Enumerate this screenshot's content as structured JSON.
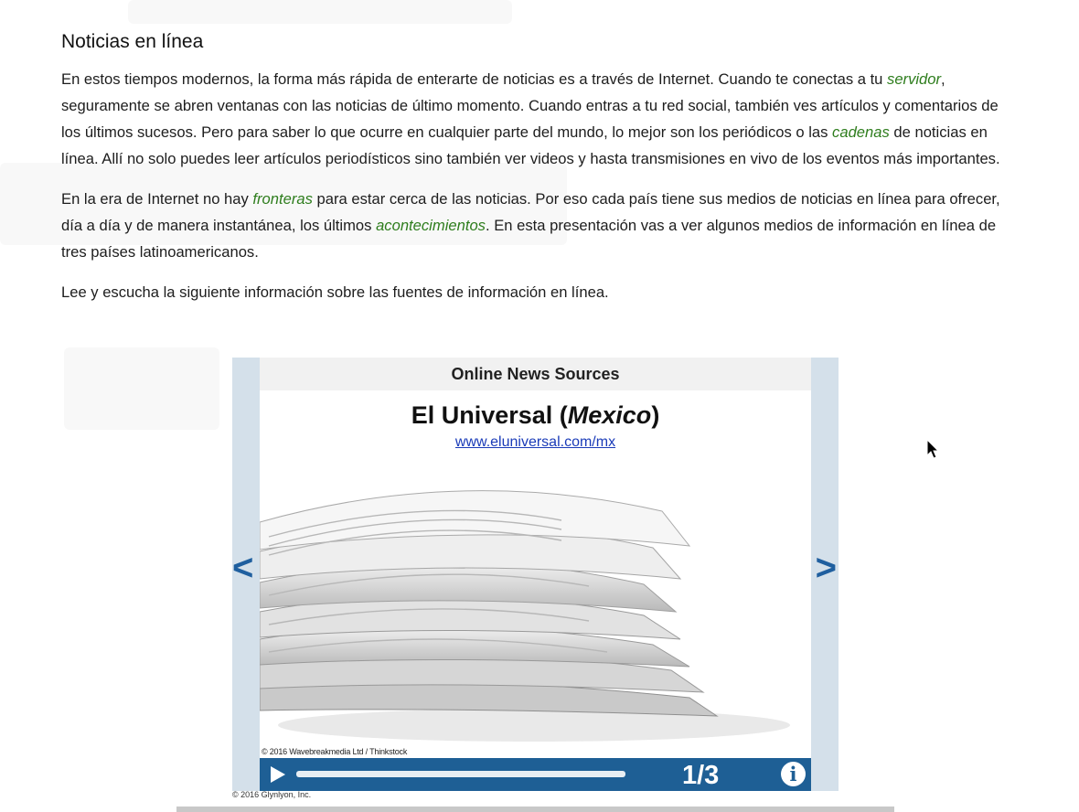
{
  "article": {
    "title": "Noticias en línea",
    "p1": {
      "t1": "En estos tiempos modernos, la forma más rápida de enterarte de noticias es a través de Internet. Cuando te conectas a tu ",
      "v1": "servidor",
      "t2": ", seguramente se abren ventanas con las noticias de último momento. Cuando entras a tu red social, también ves artículos y comentarios de los últimos sucesos. Pero para saber lo que ocurre en cualquier parte del mundo, lo mejor son los periódicos o las ",
      "v2": "cadenas",
      "t3": " de noticias en línea. Allí no solo puedes leer artículos periodísticos sino también ver videos y hasta transmisiones en vivo de los eventos más importantes."
    },
    "p2": {
      "t1": "En la era de Internet no hay ",
      "v1": "fronteras",
      "t2": " para estar cerca de las noticias. Por eso cada país tiene sus medios de noticias en línea para ofrecer, día a día y de manera instantánea, los últimos ",
      "v2": "acontecimientos",
      "t3": ". En esta presentación vas a ver algunos medios de información en línea de tres países latinoamericanos."
    },
    "p3": "Lee y escucha la siguiente información sobre las fuentes de información en línea."
  },
  "slideshow": {
    "header": "Online News Sources",
    "title_main": "El Universal (",
    "title_italic": "Mexico",
    "title_end": ")",
    "link": "www.eluniversal.com/mx",
    "image_credit": "© 2016 Wavebreakmedia Ltd / Thinkstock",
    "prev_label": "<",
    "next_label": ">",
    "counter": "1/3",
    "info_label": "i",
    "progress": 0.0,
    "copyright": "© 2016 Glynlyon, Inc.",
    "icons": [
      "play-icon",
      "info-icon",
      "arrow-left-icon",
      "arrow-right-icon"
    ],
    "colors": {
      "accent": "#1e5f95",
      "frame": "#d4e0ea",
      "vocab": "#2e7d1d",
      "link": "#1a3bb8"
    }
  }
}
